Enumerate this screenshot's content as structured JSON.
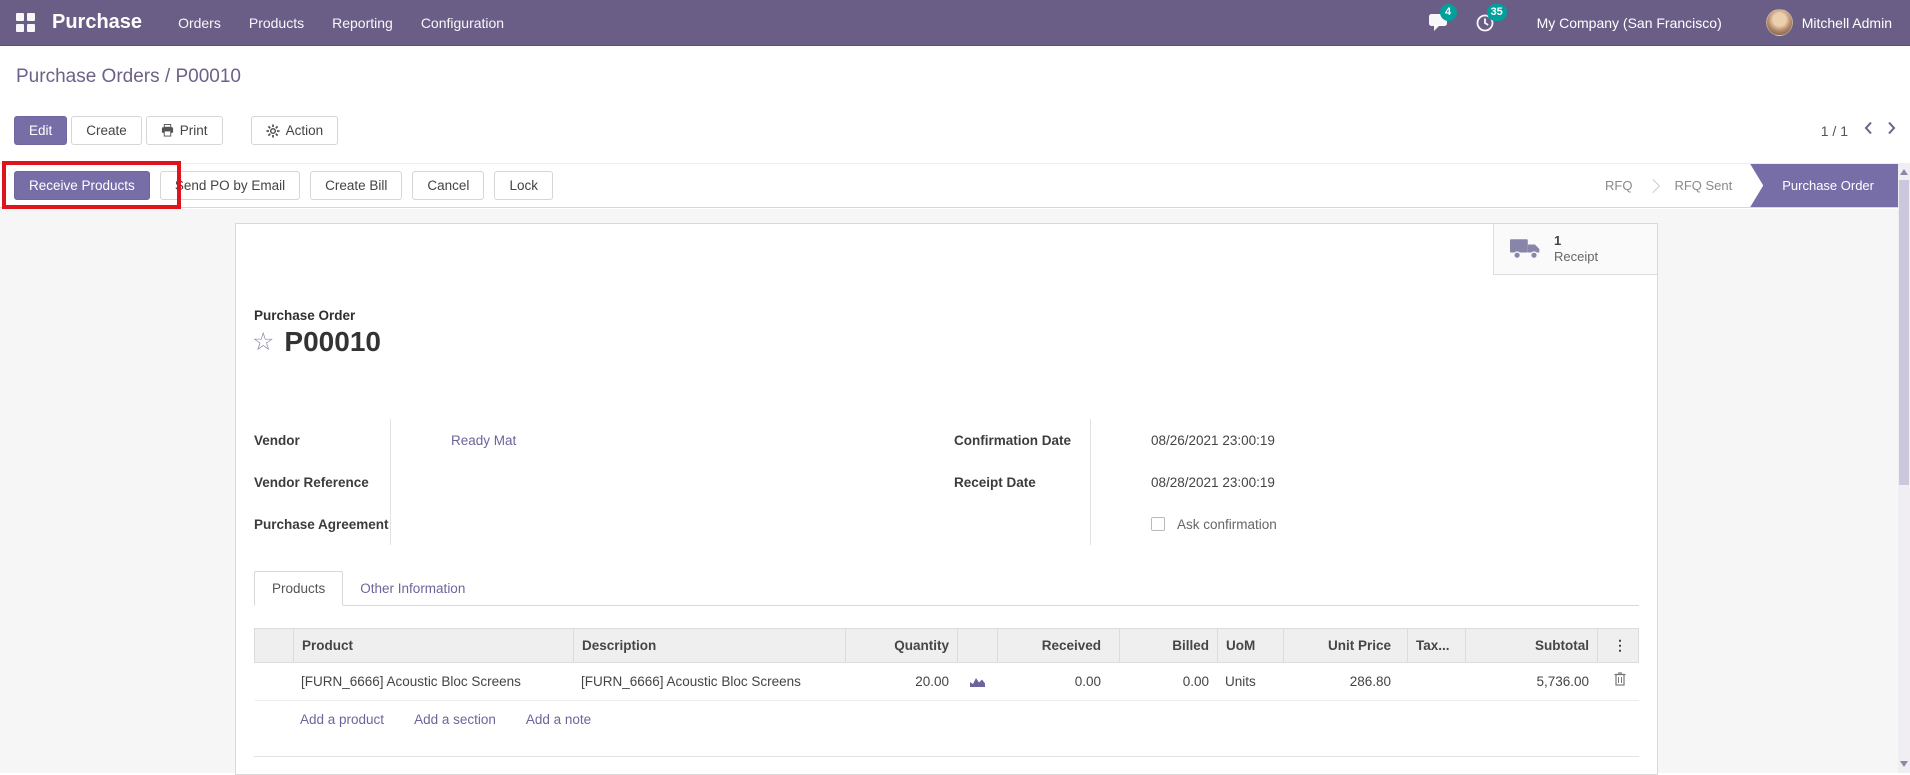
{
  "icons": {
    "star": "☆",
    "dots": "⋮"
  },
  "navbar": {
    "app_name": "Purchase",
    "menus": [
      "Orders",
      "Products",
      "Reporting",
      "Configuration"
    ],
    "messages_badge": "4",
    "activities_badge": "35",
    "company": "My Company (San Francisco)",
    "user": "Mitchell Admin"
  },
  "breadcrumb": {
    "path": "Purchase Orders / P00010"
  },
  "control_panel": {
    "edit": "Edit",
    "create": "Create",
    "print": "Print",
    "action": "Action",
    "pager": "1 / 1"
  },
  "statusbar": {
    "buttons": [
      "Receive Products",
      "Send PO by Email",
      "Create Bill",
      "Cancel",
      "Lock"
    ],
    "stages": [
      "RFQ",
      "RFQ Sent",
      "Purchase Order"
    ],
    "active_stage": "Purchase Order"
  },
  "smart_button": {
    "count": "1",
    "label": "Receipt"
  },
  "document": {
    "type_label": "Purchase Order",
    "name": "P00010"
  },
  "fields": {
    "vendor": {
      "label": "Vendor",
      "value": "Ready Mat"
    },
    "vendor_reference": {
      "label": "Vendor Reference",
      "value": ""
    },
    "purchase_agreement": {
      "label": "Purchase Agreement",
      "value": ""
    },
    "confirmation_date": {
      "label": "Confirmation Date",
      "value": "08/26/2021 23:00:19"
    },
    "receipt_date": {
      "label": "Receipt Date",
      "value": "08/28/2021 23:00:19"
    },
    "ask_confirmation": {
      "label": "Ask confirmation"
    }
  },
  "tabs": [
    "Products",
    "Other Information"
  ],
  "table": {
    "headers": [
      "Product",
      "Description",
      "Quantity",
      "Received",
      "Billed",
      "UoM",
      "Unit Price",
      "Tax...",
      "Subtotal"
    ],
    "rows": [
      {
        "product": "[FURN_6666] Acoustic Bloc Screens",
        "description": "[FURN_6666] Acoustic Bloc Screens",
        "quantity": "20.00",
        "received": "0.00",
        "billed": "0.00",
        "uom": "Units",
        "unit_price": "286.80",
        "tax": "",
        "subtotal": "5,736.00"
      }
    ],
    "footer_links": [
      "Add a product",
      "Add a section",
      "Add a note"
    ]
  },
  "colors": {
    "accent": "#776ea8",
    "badge": "#00a09d",
    "annotation_red": "#e0121b",
    "link": "#6f639b",
    "navbar": "#6a5e86"
  }
}
